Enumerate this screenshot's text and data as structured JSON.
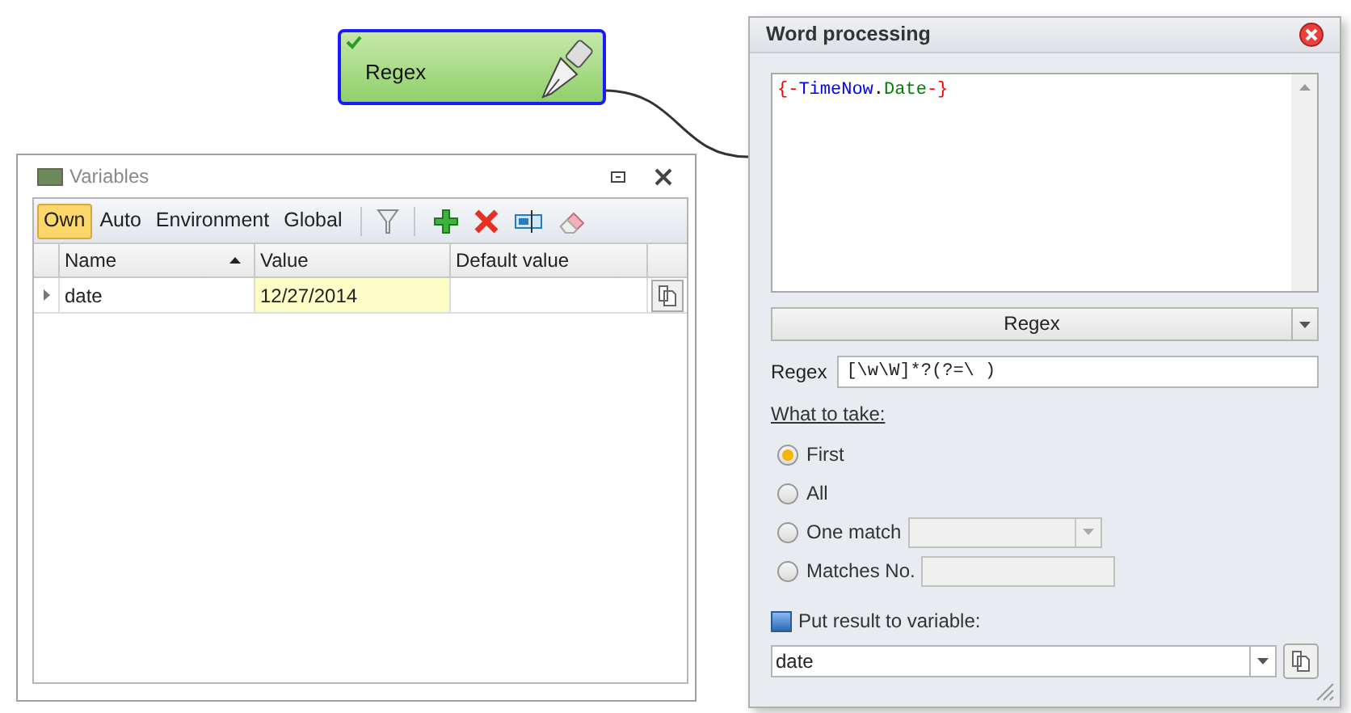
{
  "node": {
    "title": "Regex",
    "done": true,
    "selected": true
  },
  "variables_window": {
    "title": "Variables",
    "tabs": [
      {
        "label": "Own",
        "selected": true
      },
      {
        "label": "Auto",
        "selected": false
      },
      {
        "label": "Environment",
        "selected": false
      },
      {
        "label": "Global",
        "selected": false
      }
    ],
    "table": {
      "columns": [
        {
          "label": "Name",
          "sorted_ascending": true
        },
        {
          "label": "Value"
        },
        {
          "label": "Default value"
        }
      ],
      "rows": [
        {
          "name": "date",
          "value": "12/27/2014",
          "current": true
        }
      ]
    }
  },
  "word_processing": {
    "title": "Word processing",
    "text": [
      {
        "text": "{-",
        "color": "#ff0000"
      },
      {
        "text": "TimeNow",
        "color": "#0000ff"
      },
      {
        "text": ".",
        "color": "#000000"
      },
      {
        "text": "Date",
        "color": "#008000"
      },
      {
        "text": "-}",
        "color": "#ff0000"
      }
    ],
    "mode": "Regex",
    "regex_label": "Regex",
    "regex": "[\\w\\W]*?(?=\\ )",
    "what_to_take_label": "What to take:",
    "options": [
      {
        "label": "First",
        "selected": true,
        "kind": "plain"
      },
      {
        "label": "All",
        "selected": false,
        "kind": "plain"
      },
      {
        "label": "One match",
        "selected": false,
        "kind": "combo"
      },
      {
        "label": "Matches No.",
        "selected": false,
        "kind": "field"
      }
    ],
    "put_result": {
      "label": "Put result to variable:",
      "checked": true
    },
    "variable": "date"
  }
}
